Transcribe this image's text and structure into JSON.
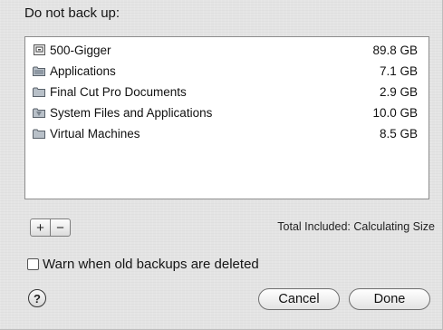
{
  "dialog": {
    "heading": "Do not back up:",
    "items": [
      {
        "icon": "hard-drive-icon",
        "name": "500-Gigger",
        "size": "89.8 GB"
      },
      {
        "icon": "folder-icon",
        "name": "Applications",
        "size": "7.1 GB"
      },
      {
        "icon": "folder-icon",
        "name": "Final Cut Pro Documents",
        "size": "2.9 GB"
      },
      {
        "icon": "folder-icon",
        "name": "System Files and Applications",
        "size": "10.0 GB"
      },
      {
        "icon": "folder-icon",
        "name": "Virtual Machines",
        "size": "8.5 GB"
      }
    ],
    "add_label": "+",
    "remove_label": "−",
    "total_text": "Total Included: Calculating Size",
    "warn_label": "Warn when old backups are deleted",
    "warn_checked": false,
    "help_label": "?",
    "cancel_label": "Cancel",
    "done_label": "Done"
  }
}
